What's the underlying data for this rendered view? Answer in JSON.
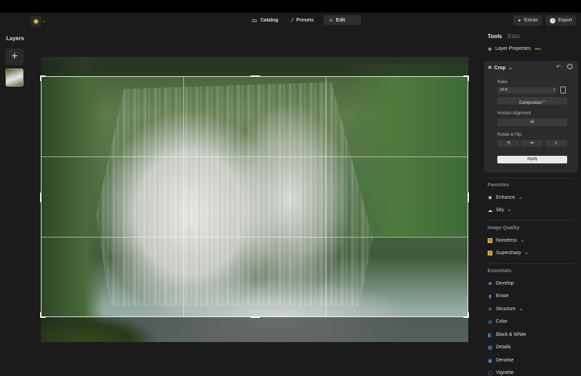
{
  "toolbar": {
    "catalog": "Catalog",
    "presets": "Presets",
    "edit": "Edit",
    "extras": "Extras",
    "export": "Export"
  },
  "layers": {
    "title": "Layers",
    "add_icon": "plus-icon"
  },
  "right_panel": {
    "tab_tools": "Tools",
    "tab_edits": "Edits",
    "layer_properties": "Layer Properties",
    "pro_badge": "PRO",
    "crop": {
      "title": "Crop",
      "ai_badge": "AI",
      "ratio_label": "Ratio:",
      "ratio_value": "16:9",
      "composition": "Composition",
      "composition_badge": "AI",
      "horizon_label": "Horizon Alignment",
      "rotate_label": "Rotate & Flip",
      "apply": "Apply"
    },
    "sections": [
      {
        "title": "Favorites",
        "items": [
          {
            "label": "Enhance",
            "ai": "AI",
            "icon": "sparkle-icon"
          },
          {
            "label": "Sky",
            "ai": "AI",
            "icon": "cloud-icon"
          }
        ]
      },
      {
        "title": "Image Quality",
        "items": [
          {
            "label": "Noiseless",
            "ai": "AI",
            "icon": "noiseless-icon"
          },
          {
            "label": "Supersharp",
            "ai": "AI",
            "icon": "supersharp-icon"
          }
        ]
      },
      {
        "title": "Essentials",
        "items": [
          {
            "label": "Develop",
            "ai": "",
            "icon": "sun-icon"
          },
          {
            "label": "Erase",
            "ai": "",
            "icon": "eraser-icon"
          },
          {
            "label": "Structure",
            "ai": "AI",
            "icon": "structure-icon"
          },
          {
            "label": "Color",
            "ai": "",
            "icon": "color-icon"
          },
          {
            "label": "Black & White",
            "ai": "",
            "icon": "bw-icon"
          },
          {
            "label": "Details",
            "ai": "",
            "icon": "details-icon"
          },
          {
            "label": "Denoise",
            "ai": "",
            "icon": "denoise-icon"
          },
          {
            "label": "Vignette",
            "ai": "",
            "icon": "vignette-icon"
          }
        ]
      }
    ]
  },
  "colors": {
    "accent_gold": "#e9b13c",
    "panel_bg": "#2b2b2d",
    "icon_blue": "#4d8fe8"
  }
}
